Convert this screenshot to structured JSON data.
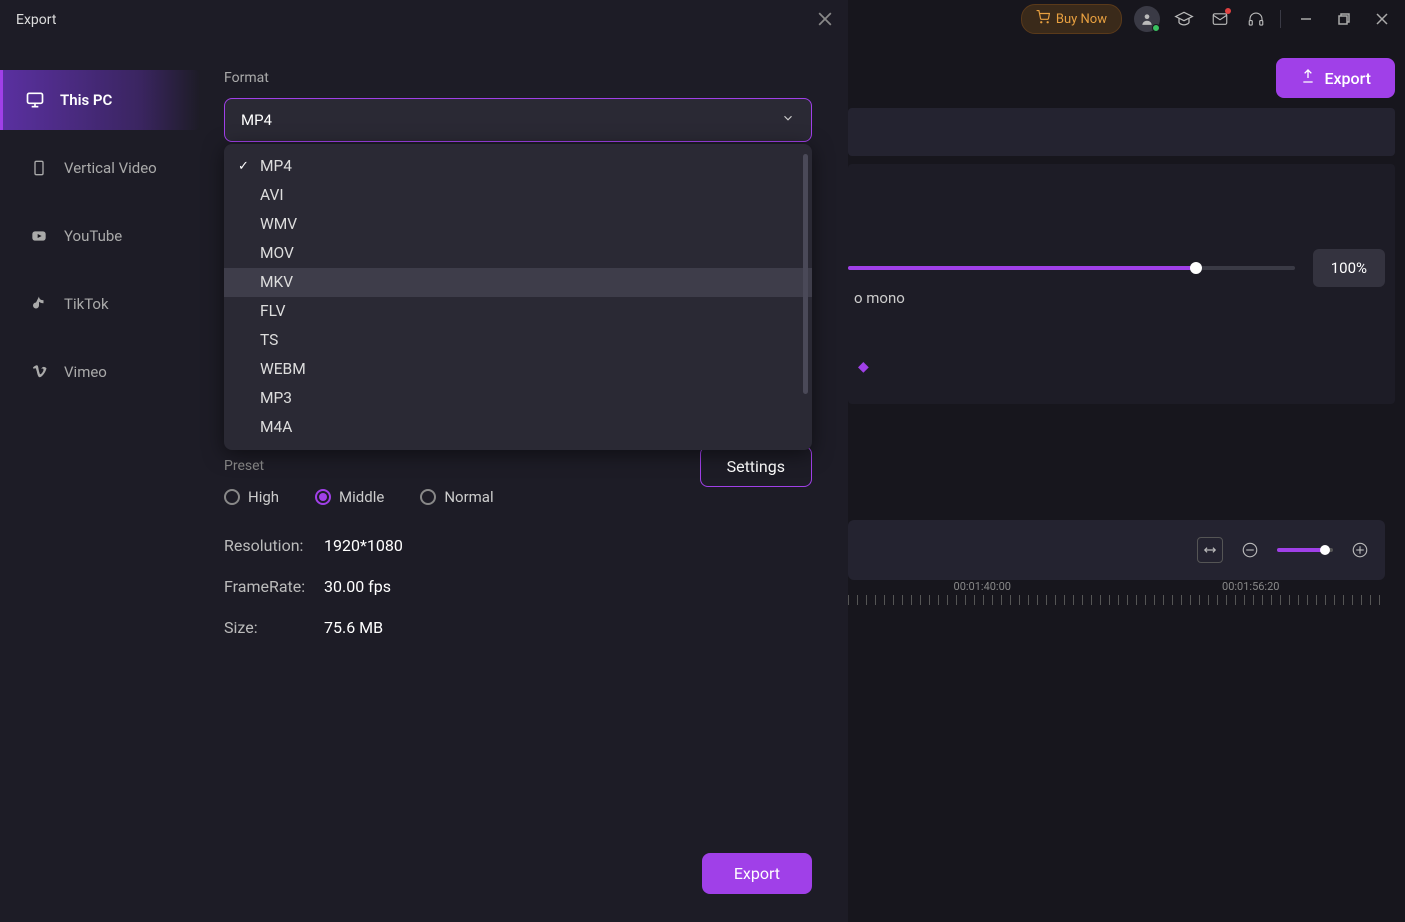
{
  "header": {
    "buy_now": "Buy Now",
    "export_label": "Export"
  },
  "right": {
    "percent": "100%",
    "mono": "o mono",
    "timeline": {
      "timestamps": [
        "00:01:40:00",
        "00:01:56:20"
      ]
    }
  },
  "modal": {
    "title": "Export"
  },
  "sidebar": {
    "items": [
      {
        "label": "This PC",
        "icon": "monitor"
      },
      {
        "label": "Vertical Video",
        "icon": "phone"
      },
      {
        "label": "YouTube",
        "icon": "youtube"
      },
      {
        "label": "TikTok",
        "icon": "tiktok"
      },
      {
        "label": "Vimeo",
        "icon": "vimeo"
      }
    ]
  },
  "main": {
    "format_label": "Format",
    "format_value": "MP4",
    "format_options": [
      "MP4",
      "AVI",
      "WMV",
      "MOV",
      "MKV",
      "FLV",
      "TS",
      "WEBM",
      "MP3",
      "M4A"
    ],
    "format_selected": "MP4",
    "format_hovered": "MKV",
    "preset_label": "Preset",
    "presets": [
      "High",
      "Middle",
      "Normal"
    ],
    "preset_selected": "Middle",
    "settings_label": "Settings",
    "info": {
      "resolution_key": "Resolution:",
      "resolution_val": "1920*1080",
      "framerate_key": "FrameRate:",
      "framerate_val": "30.00 fps",
      "size_key": "Size:",
      "size_val": "75.6 MB"
    },
    "export_label": "Export"
  }
}
